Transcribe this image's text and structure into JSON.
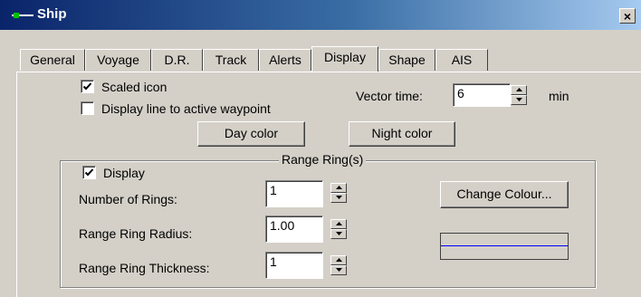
{
  "window": {
    "title": "Ship",
    "close_label": "×"
  },
  "tabs": [
    {
      "label": "General",
      "active": false
    },
    {
      "label": "Voyage",
      "active": false
    },
    {
      "label": "D.R.",
      "active": false
    },
    {
      "label": "Track",
      "active": false
    },
    {
      "label": "Alerts",
      "active": false
    },
    {
      "label": "Display",
      "active": true
    },
    {
      "label": "Shape",
      "active": false
    },
    {
      "label": "AIS",
      "active": false
    }
  ],
  "display": {
    "scaled_icon": {
      "label": "Scaled icon",
      "checked": true
    },
    "active_waypoint": {
      "label": "Display line to active waypoint",
      "checked": false
    },
    "vector_time": {
      "label": "Vector time:",
      "value": "6",
      "unit": "min"
    },
    "day_color_label": "Day color",
    "night_color_label": "Night color"
  },
  "range_rings": {
    "title": "Range Ring(s)",
    "display": {
      "label": "Display",
      "checked": true
    },
    "number_of_rings": {
      "label": "Number of Rings:",
      "value": "1"
    },
    "radius": {
      "label": "Range Ring Radius:",
      "value": "1.00"
    },
    "thickness": {
      "label": "Range Ring Thickness:",
      "value": "1"
    },
    "change_colour_label": "Change Colour...",
    "ring_colour": "#0000ff"
  },
  "colors": {
    "titlebar_start": "#0a246a",
    "titlebar_end": "#a6caf0",
    "face": "#d4d0c8"
  },
  "icons": {
    "ship": "ship-icon",
    "close": "close-icon",
    "check": "checkmark-icon",
    "spin_up": "spin-up-arrow-icon",
    "spin_down": "spin-down-arrow-icon"
  }
}
